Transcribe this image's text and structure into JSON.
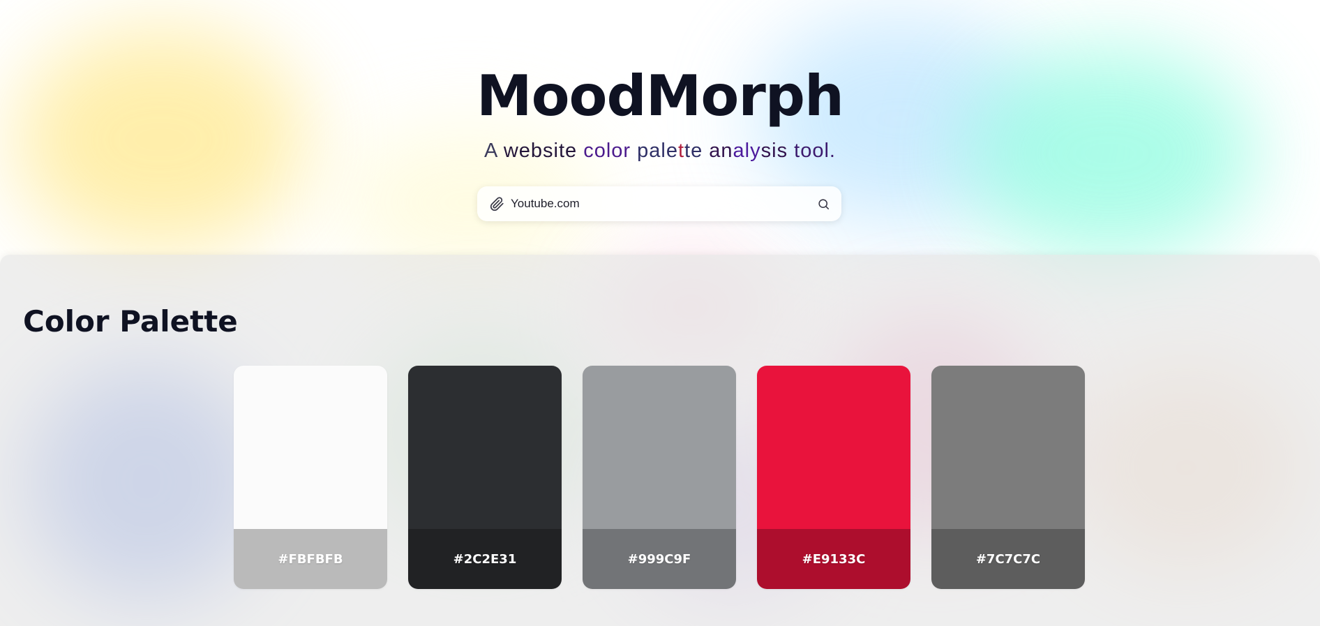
{
  "app": {
    "title": "MoodMorph",
    "subtitle_words": [
      "A",
      "website",
      "color",
      "pale",
      "t",
      "te",
      "an",
      "aly",
      "sis",
      "tool."
    ]
  },
  "search": {
    "value": "Youtube.com",
    "placeholder": "Youtube.com",
    "left_icon": "paperclip-icon",
    "right_icon": "search-icon"
  },
  "palette": {
    "heading": "Color Palette",
    "swatches": [
      {
        "hex_label": "#FBFBFB",
        "color": "#FBFBFB",
        "shade": "#BABABA"
      },
      {
        "hex_label": "#2C2E31",
        "color": "#2C2E31",
        "shade": "#212224"
      },
      {
        "hex_label": "#999C9F",
        "color": "#999C9F",
        "shade": "#727477"
      },
      {
        "hex_label": "#E9133C",
        "color": "#E9133C",
        "shade": "#AD0E2D"
      },
      {
        "hex_label": "#7C7C7C",
        "color": "#7C7C7C",
        "shade": "#5D5D5D"
      }
    ]
  },
  "colors": {
    "title": "#0F1222",
    "background_blobs": [
      "#FFE88A",
      "#9EE7FF",
      "#7FFFE0",
      "#8FA8EA",
      "#F0A6C8",
      "#F2D5BE"
    ]
  }
}
